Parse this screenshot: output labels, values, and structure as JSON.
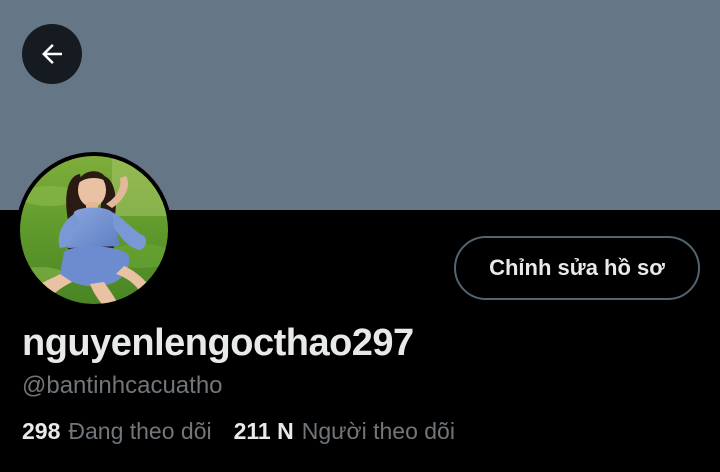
{
  "header": {
    "back_icon": "arrow-left-icon",
    "banner_color": "#657786"
  },
  "profile": {
    "display_name": "nguyenlengocthao297",
    "handle": "@bantinhcacuatho",
    "edit_button_label": "Chỉnh sửa hồ sơ",
    "avatar": "profile-photo"
  },
  "stats": {
    "following_count": "298",
    "following_label": "Đang theo dõi",
    "followers_count": "211 N",
    "followers_label": "Người theo dõi"
  },
  "colors": {
    "background": "#000000",
    "primary_text": "#e7e9ea",
    "secondary_text": "#71767b",
    "button_border": "#536471"
  }
}
